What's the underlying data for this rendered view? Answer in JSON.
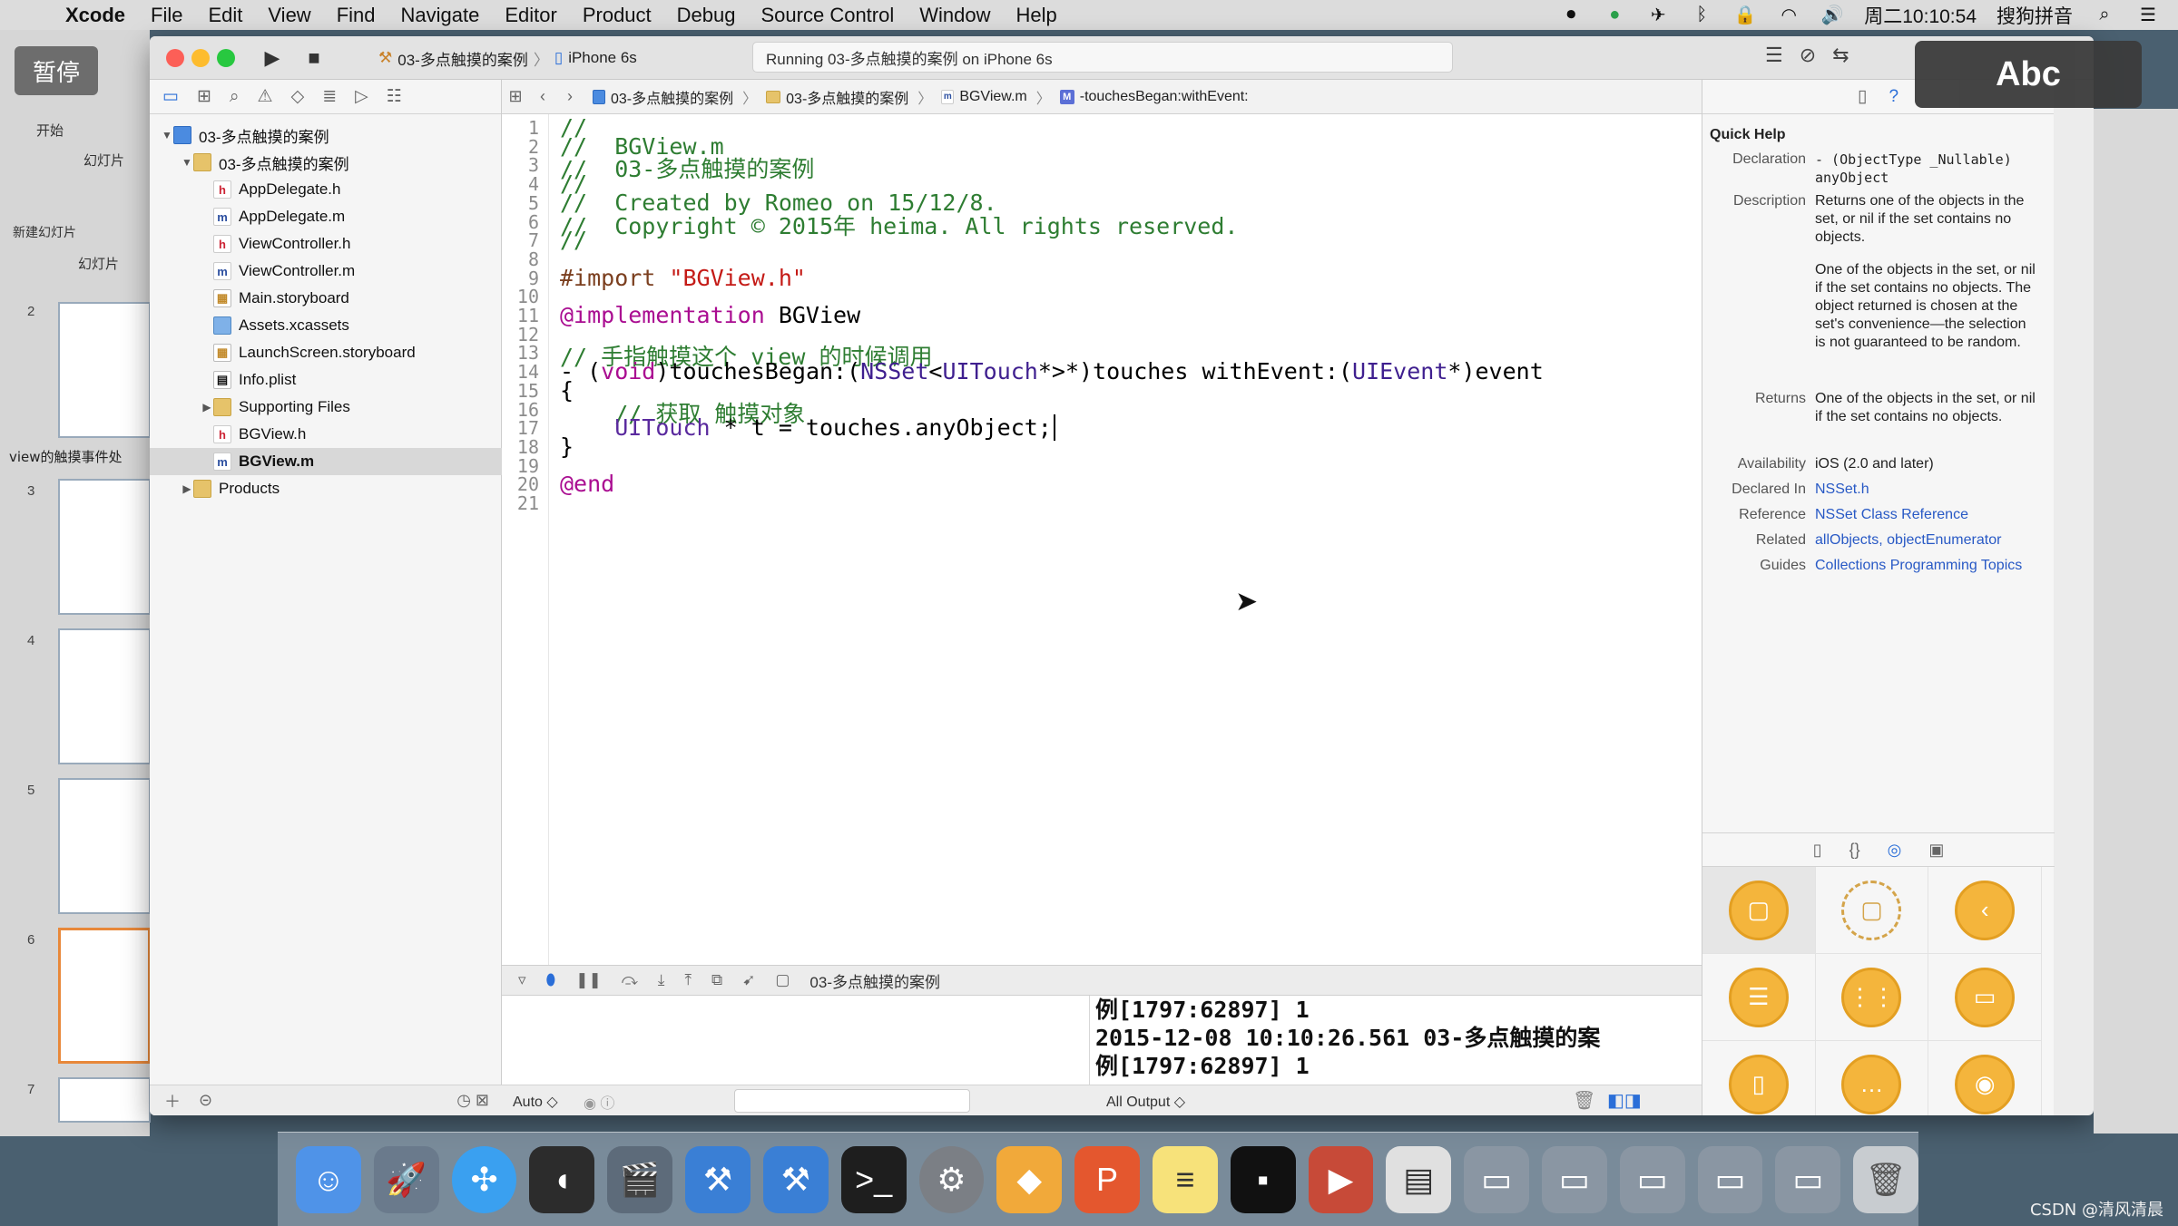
{
  "menubar": {
    "app": "Xcode",
    "items": [
      "File",
      "Edit",
      "View",
      "Find",
      "Navigate",
      "Editor",
      "Product",
      "Debug",
      "Source Control",
      "Window",
      "Help"
    ],
    "clock": "周二10:10:54",
    "input_method": "搜狗拼音"
  },
  "keynote": {
    "pause_label": "暂停",
    "start_label": "开始",
    "slides_label": "幻灯片",
    "new_slide_label": "新建幻灯片",
    "slides_header": "幻灯片",
    "group_label": "view的触摸事件处",
    "slide_numbers": [
      "2",
      "3",
      "4",
      "5",
      "6",
      "7"
    ]
  },
  "xcode": {
    "scheme": "03-多点触摸的案例",
    "device": "iPhone 6s",
    "status": "Running 03-多点触摸的案例 on iPhone 6s",
    "breadcrumbs": [
      "03-多点触摸的案例",
      "03-多点触摸的案例",
      "BGView.m",
      "-touchesBegan:withEvent:"
    ],
    "navigator": {
      "rows": [
        {
          "label": "03-多点触摸的案例",
          "kind": "proj",
          "indent": 0,
          "tri": "▼"
        },
        {
          "label": "03-多点触摸的案例",
          "kind": "folder",
          "indent": 1,
          "tri": "▼"
        },
        {
          "label": "AppDelegate.h",
          "kind": "h",
          "indent": 2,
          "tri": ""
        },
        {
          "label": "AppDelegate.m",
          "kind": "m",
          "indent": 2,
          "tri": ""
        },
        {
          "label": "ViewController.h",
          "kind": "h",
          "indent": 2,
          "tri": ""
        },
        {
          "label": "ViewController.m",
          "kind": "m",
          "indent": 2,
          "tri": ""
        },
        {
          "label": "Main.storyboard",
          "kind": "sb",
          "indent": 2,
          "tri": ""
        },
        {
          "label": "Assets.xcassets",
          "kind": "assets",
          "indent": 2,
          "tri": ""
        },
        {
          "label": "LaunchScreen.storyboard",
          "kind": "sb",
          "indent": 2,
          "tri": ""
        },
        {
          "label": "Info.plist",
          "kind": "plist",
          "indent": 2,
          "tri": ""
        },
        {
          "label": "Supporting Files",
          "kind": "folder",
          "indent": 2,
          "tri": "▶"
        },
        {
          "label": "BGView.h",
          "kind": "h",
          "indent": 2,
          "tri": ""
        },
        {
          "label": "BGView.m",
          "kind": "m",
          "indent": 2,
          "tri": "",
          "selected": true
        },
        {
          "label": "Products",
          "kind": "folder",
          "indent": 1,
          "tri": "▶"
        }
      ]
    },
    "code_lines": [
      "1",
      "2",
      "3",
      "4",
      "5",
      "6",
      "7",
      "8",
      "9",
      "10",
      "11",
      "12",
      "13",
      "14",
      "15",
      "16",
      "17",
      "18",
      "19",
      "20",
      "21"
    ],
    "code": {
      "l1": "//",
      "l2": "//  BGView.m",
      "l3": "//  03-多点触摸的案例",
      "l4": "//",
      "l5": "//  Created by Romeo on 15/12/8.",
      "l6": "//  Copyright © 2015年 heima. All rights reserved.",
      "l7": "//",
      "l9_import": "#import",
      "l9_str": "\"BGView.h\"",
      "l11_kw": "@implementation",
      "l11_name": " BGView",
      "l13": "// 手指触摸这个 view 的时候调用",
      "l14_a": "- (",
      "l14_void": "void",
      "l14_b": ")touchesBegan:(",
      "l14_nsset": "NSSet",
      "l14_c": "<",
      "l14_uitouch": "UITouch",
      "l14_d": "*>*)touches withEvent:(",
      "l14_uievent": "UIEvent",
      "l14_e": "*)event",
      "l15": "{",
      "l16": "    // 获取 触摸对象",
      "l17_type": "    UITouch",
      "l17_rest": " * t = touches.anyObject;",
      "l18": "}",
      "l20": "@end"
    },
    "debug_target": "03-多点触摸的案例",
    "console_lines": [
      "例[1797:62897] 1",
      "2015-12-08 10:10:26.561 03-多点触摸的案",
      "例[1797:62897] 1"
    ],
    "var_scope": "Auto ◇",
    "console_filter": "All Output ◇",
    "quick_help": {
      "title": "Quick Help",
      "declaration_label": "Declaration",
      "declaration": "- (ObjectType _Nullable) anyObject",
      "description_label": "Description",
      "description1": "Returns one of the objects in the set, or nil if the set contains no objects.",
      "description2": "One of the objects in the set, or nil if the set contains no objects. The object returned is chosen at the set's convenience—the selection is not guaranteed to be random.",
      "returns_label": "Returns",
      "returns": "One of the objects in the set, or nil if the set contains no objects.",
      "availability_label": "Availability",
      "availability": "iOS (2.0 and later)",
      "declared_in_label": "Declared In",
      "declared_in": "NSSet.h",
      "reference_label": "Reference",
      "reference": "NSSet Class Reference",
      "related_label": "Related",
      "related": "allObjects, objectEnumerator",
      "guides_label": "Guides",
      "guides": "Collections Programming Topics"
    }
  },
  "overlay": {
    "abc": "Abc"
  },
  "watermark": "CSDN @清风清晨",
  "colors": {
    "accent": "#2a6ed8",
    "comment": "#2e7d32",
    "keyword": "#aa0d91",
    "string": "#c41a16"
  }
}
